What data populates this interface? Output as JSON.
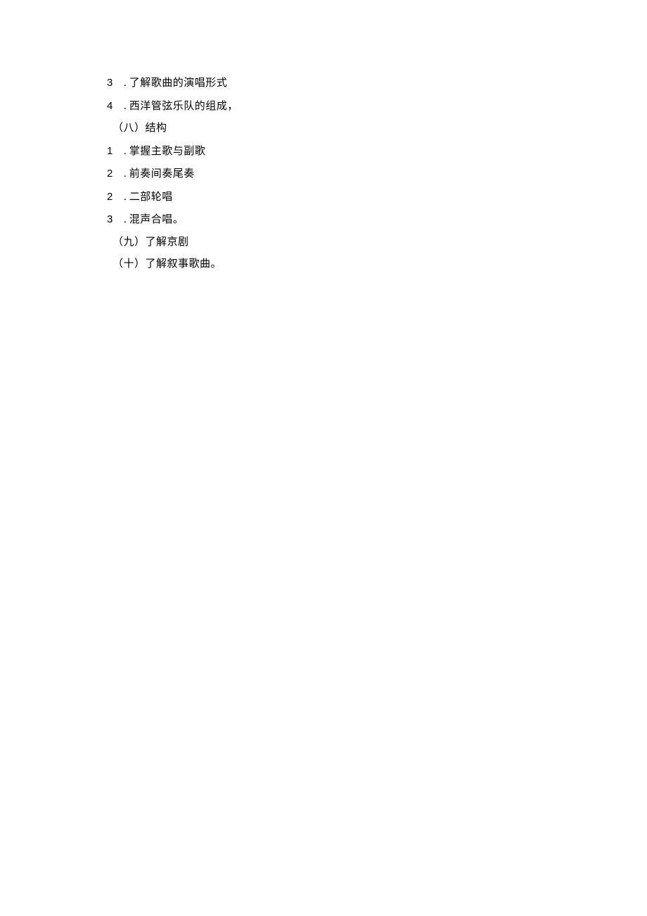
{
  "lines": [
    {
      "num": "3",
      "sep": ".",
      "text": "了解歌曲的演唱形式",
      "type": "numbered"
    },
    {
      "num": "4",
      "sep": ".",
      "text": "西洋管弦乐队的组成，",
      "type": "numbered"
    },
    {
      "text": "（八）结构",
      "type": "indent"
    },
    {
      "num": "1",
      "sep": ".",
      "text": " 掌握主歌与副歌",
      "type": "numbered"
    },
    {
      "num": "2",
      "sep": ".",
      "text": "前奏间奏尾奏",
      "type": "numbered"
    },
    {
      "num": "2",
      "sep": ".",
      "text": " 二部轮唱",
      "type": "numbered"
    },
    {
      "num": "3",
      "sep": ".",
      "text": " 混声合唱。",
      "type": "numbered"
    },
    {
      "text": "（九）了解京剧",
      "type": "indent"
    },
    {
      "text": "（十）了解叙事歌曲。",
      "type": "indent"
    }
  ]
}
